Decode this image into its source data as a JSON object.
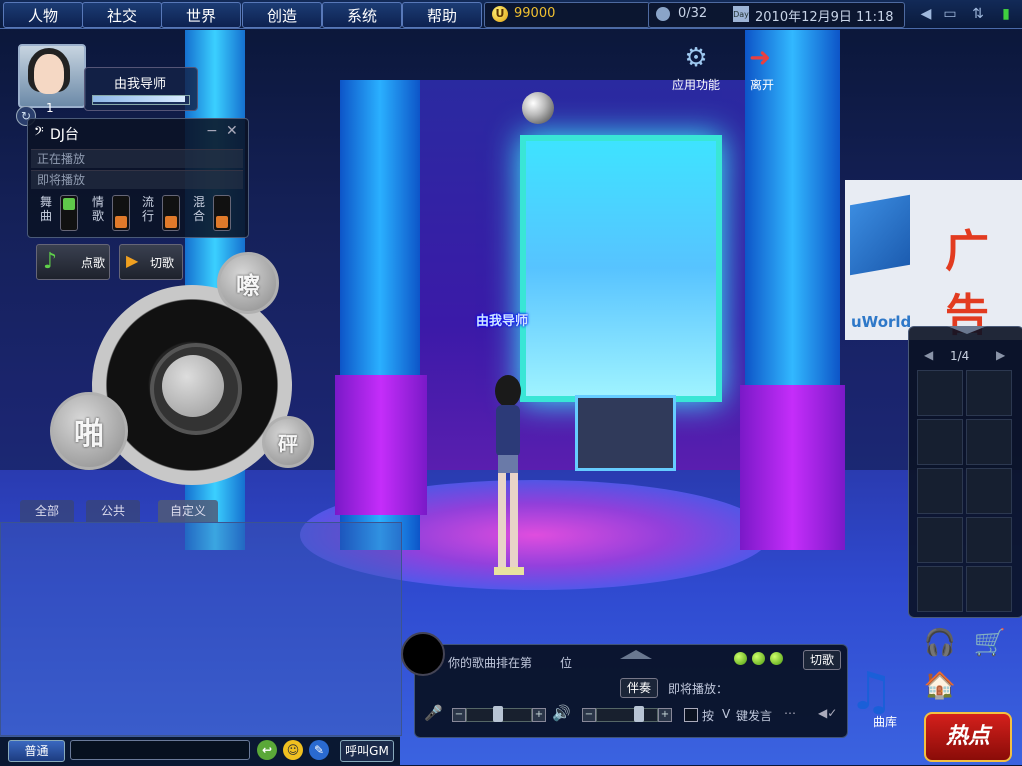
{
  "menu": {
    "items": [
      "人物",
      "社交",
      "世界",
      "创造",
      "系统",
      "帮助"
    ]
  },
  "currency": {
    "icon": "U",
    "amount": "99000"
  },
  "status": {
    "slots": "0/32",
    "calendar_label": "Day",
    "datetime": "2010年12月9日 11:18"
  },
  "player": {
    "name": "由我导师",
    "level": "1",
    "hp_fraction": 0.98
  },
  "dj": {
    "title": "DJ台",
    "now_playing_label": "正在播放",
    "next_label": "即将播放",
    "genres": [
      {
        "label": "舞曲",
        "state": "on"
      },
      {
        "label": "情歌",
        "state": "off"
      },
      {
        "label": "流行",
        "state": "off"
      },
      {
        "label": "混合",
        "state": "off"
      }
    ],
    "request_btn": "点歌",
    "skip_btn": "切歌",
    "sounds": {
      "top": "嚓",
      "left": "啪",
      "right": "砰"
    }
  },
  "chat": {
    "tabs": [
      "全部",
      "公共",
      "自定义"
    ],
    "channel_btn": "普通",
    "input_value": "",
    "gm_btn": "呼叫GM"
  },
  "apps": {
    "functions_label": "应用功能",
    "leave_label": "离开"
  },
  "npc_name": "由我导师",
  "banner": {
    "text": "广告",
    "brand": "uWorld"
  },
  "music": {
    "queue_prefix": "你的歌曲排在第",
    "queue_suffix": "位",
    "cut_btn": "切歌",
    "accomp_btn": "伴奏",
    "next_label": "即将播放：",
    "press_v_a": "按",
    "press_v_key": "V",
    "press_v_b": "键发言",
    "mic_level": 0.5,
    "volume_level": 0.75,
    "library_label": "曲库"
  },
  "inventory": {
    "page": "1/4"
  },
  "hot_btn": "热点"
}
